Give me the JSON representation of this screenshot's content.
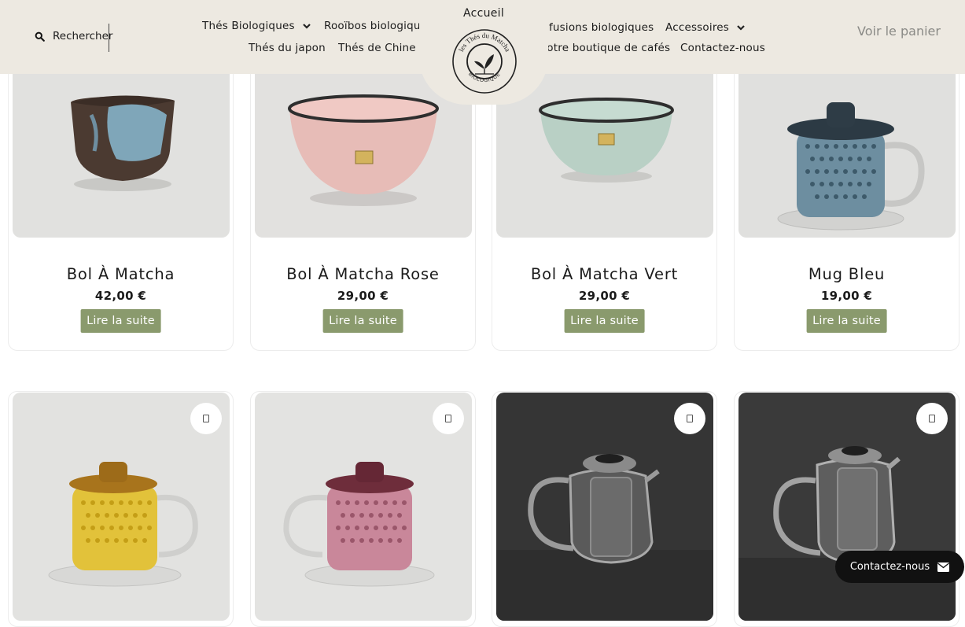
{
  "header": {
    "search_label": "Rechercher",
    "home_label": "Accueil",
    "cart_label": "Voir le panier",
    "nav_left": [
      {
        "label": "Thés Biologiques",
        "dropdown": true
      },
      {
        "label": "Rooïbos biologiques",
        "dropdown": false
      },
      {
        "label": "Thés du japon",
        "dropdown": false
      },
      {
        "label": "Thés de Chine",
        "dropdown": true
      }
    ],
    "nav_right": [
      {
        "label": "Infusions biologiques",
        "dropdown": false
      },
      {
        "label": "Accessoires",
        "dropdown": true
      },
      {
        "label": "Notre boutique de cafés",
        "dropdown": false
      },
      {
        "label": "Contactez-nous",
        "dropdown": false
      }
    ],
    "logo_text": {
      "top": "les Thés du Matcha",
      "bottom": "BIOLOGIQUE"
    }
  },
  "products_row1": [
    {
      "name": "Bol À Matcha",
      "price": "42,00 €",
      "button": "Lire la suite",
      "image": "brown-blue-matcha-bowl"
    },
    {
      "name": "Bol À Matcha Rose",
      "price": "29,00 €",
      "button": "Lire la suite",
      "image": "pink-matcha-bowl"
    },
    {
      "name": "Bol À Matcha Vert",
      "price": "29,00 €",
      "button": "Lire la suite",
      "image": "green-matcha-bowl"
    },
    {
      "name": "Mug Bleu",
      "price": "19,00 €",
      "button": "Lire la suite",
      "image": "blue-glass-mug"
    }
  ],
  "products_row2": [
    {
      "image": "yellow-glass-mug",
      "wishlist_icon": "wishlist-icon"
    },
    {
      "image": "pink-glass-mug",
      "wishlist_icon": "wishlist-icon"
    },
    {
      "image": "glass-teapot",
      "wishlist_icon": "wishlist-icon"
    },
    {
      "image": "glass-teapot-tall",
      "wishlist_icon": "wishlist-icon"
    }
  ],
  "contact_button": {
    "label": "Contactez-nous",
    "icon": "envelope-icon"
  },
  "colors": {
    "header_bg": "#ede9e1",
    "button_bg": "#8a9a6d",
    "button_text": "#ffffff",
    "pill_bg": "#111111"
  }
}
